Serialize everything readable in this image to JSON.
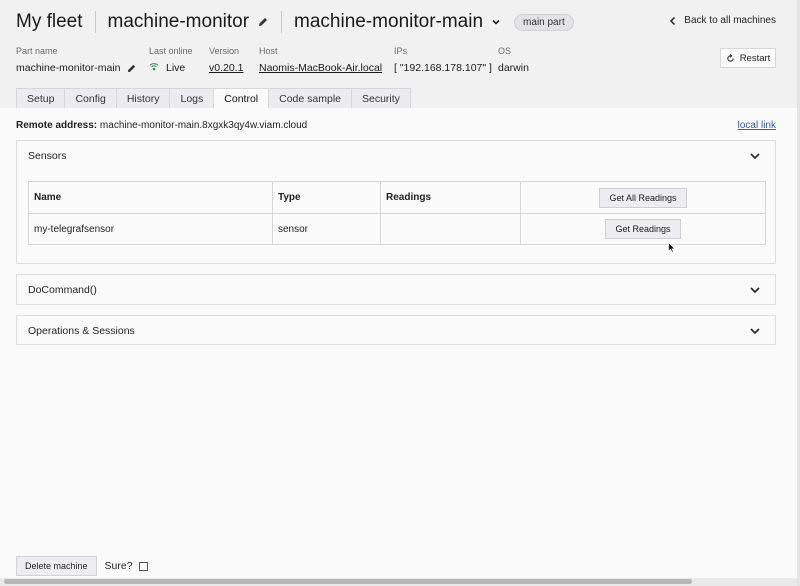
{
  "header": {
    "fleet": "My fleet",
    "machine": "machine-monitor",
    "part": "machine-monitor-main",
    "badge": "main part",
    "back": "Back to all machines"
  },
  "meta": {
    "part_name_label": "Part name",
    "part_name": "machine-monitor-main",
    "last_online_label": "Last online",
    "last_online": "Live",
    "version_label": "Version",
    "version": "v0.20.1",
    "host_label": "Host",
    "host": "Naomis-MacBook-Air.local",
    "ips_label": "IPs",
    "ips": "[ \"192.168.178.107\" ]",
    "os_label": "OS",
    "os": "darwin"
  },
  "restart": "Restart",
  "tabs": [
    "Setup",
    "Config",
    "History",
    "Logs",
    "Control",
    "Code sample",
    "Security"
  ],
  "active_tab": "Control",
  "remote": {
    "label": "Remote address:",
    "value": "machine-monitor-main.8xgxk3qy4w.viam.cloud",
    "local_link": "local link"
  },
  "sensors": {
    "title": "Sensors",
    "columns": [
      "Name",
      "Type",
      "Readings"
    ],
    "get_all": "Get All Readings",
    "rows": [
      {
        "name": "my-telegrafsensor",
        "type": "sensor",
        "readings": "",
        "action": "Get Readings"
      }
    ]
  },
  "panels": {
    "docommand": "DoCommand()",
    "operations": "Operations & Sessions"
  },
  "footer": {
    "delete": "Delete machine",
    "sure": "Sure?"
  },
  "colors": {
    "accent_link": "#2f5fb0",
    "live": "#2e8b57"
  }
}
